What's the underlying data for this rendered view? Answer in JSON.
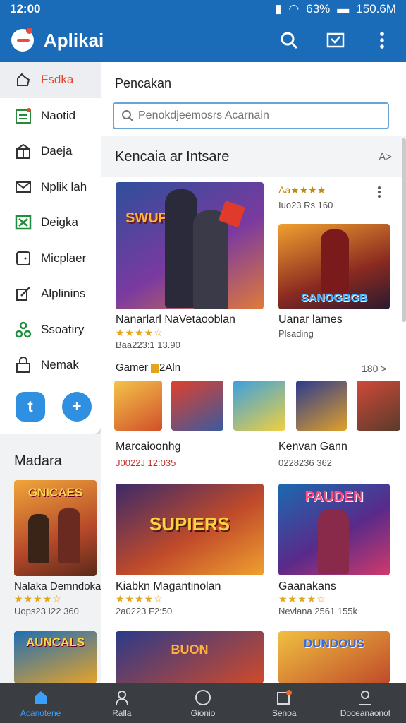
{
  "status": {
    "time": "12:00",
    "battery": "63%",
    "clock_right": "150.6M"
  },
  "appbar": {
    "title": "Aplikai"
  },
  "sidebar": {
    "items": [
      {
        "label": "Fsdka",
        "icon": "hand-pointer-icon"
      },
      {
        "label": "Naotid",
        "icon": "calendar-icon"
      },
      {
        "label": "Daeja",
        "icon": "gift-box-icon"
      },
      {
        "label": "Nplik lah",
        "icon": "mail-icon"
      },
      {
        "label": "Deigka",
        "icon": "excel-icon"
      },
      {
        "label": "Micplaer",
        "icon": "tablet-icon"
      },
      {
        "label": "Alplinins",
        "icon": "edit-icon"
      },
      {
        "label": "Ssoatiry",
        "icon": "share-nodes-icon"
      },
      {
        "label": "Nemak",
        "icon": "lock-icon"
      }
    ],
    "btn_left": "t",
    "btn_right": "+"
  },
  "main": {
    "title": "Pencakan",
    "search_placeholder": "Penokdjeemosrs Acarnain",
    "section_title": "Kencaia ar Intsare",
    "section_more": "A>",
    "featured": {
      "title": "Nanarlarl NaVetaooblan",
      "sub": "Baa223:1 13.90",
      "stars": "★★★★☆"
    },
    "side_card": {
      "rating_text": "Aa★★★★",
      "sub": "Iuo23 Rs 160",
      "title": "Uanar lames",
      "sub2": "Plsading"
    },
    "gamer_row": {
      "label": "Gamer",
      "label2": "2Aln",
      "more": "180 >"
    },
    "mid_left": {
      "title": "Marcaioonhg",
      "sub": "J0022J 12:035"
    },
    "mid_right": {
      "title": "Kenvan Gann",
      "sub": "0228236 362"
    },
    "card2": {
      "title": "Kiabkn Magantinolan",
      "sub": "2a0223 F2:50",
      "stars": "★★★★☆"
    },
    "card3": {
      "title": "Gaanakans",
      "sub": "Nevlana 2561 155k",
      "stars": "★★★★☆"
    },
    "thumb_texts": {
      "t1": "SWUPNIK",
      "t2": "SANOGBGB",
      "t3": "SUPIERS",
      "t4": "PAUDEN",
      "t5": "AUNCALS",
      "t6": "DUNDOUS"
    }
  },
  "left": {
    "heading": "Madara",
    "card": {
      "title": "Nalaka Demndoka",
      "sub": "Uops23 I22 360",
      "stars": "★★★★☆",
      "thumb": "GNICAES"
    }
  },
  "bottomnav": {
    "items": [
      {
        "label": "Acanotene",
        "icon": "home-icon",
        "active": true
      },
      {
        "label": "Ralla",
        "icon": "user-search-icon",
        "active": false
      },
      {
        "label": "Gionio",
        "icon": "circle-icon",
        "active": false
      },
      {
        "label": "Senoa",
        "icon": "notification-icon",
        "active": false
      },
      {
        "label": "Doceanaonot",
        "icon": "profile-icon",
        "active": false
      }
    ]
  },
  "colors": {
    "brand": "#1a6bb8",
    "accent": "#e14a31",
    "star": "#e3a51b"
  }
}
